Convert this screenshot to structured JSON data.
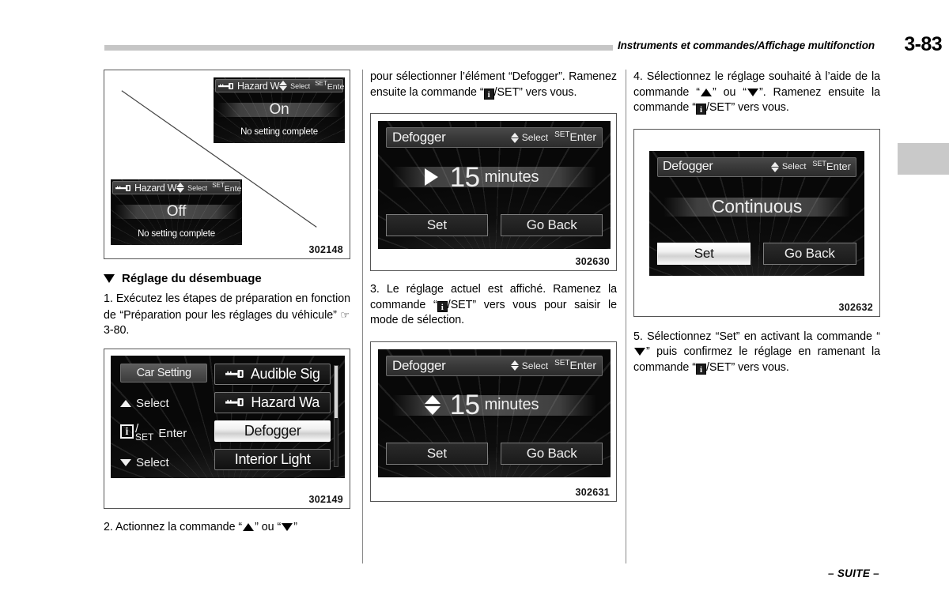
{
  "header": {
    "title": "Instruments et commandes/Affichage multifonction",
    "page_number": "3-83"
  },
  "footer": {
    "continued": "– SUITE –"
  },
  "column1": {
    "figure_hazard": {
      "caption": "302148",
      "screen_on": {
        "title": "Hazard W",
        "hint_select": "Select",
        "hint_set": "SET",
        "hint_enter": "Enter",
        "value": "On",
        "status": "No setting complete"
      },
      "screen_off": {
        "title": "Hazard W",
        "hint_select": "Select",
        "hint_set": "SET",
        "hint_enter": "Enter",
        "value": "Off",
        "status": "No setting complete"
      }
    },
    "section_heading": "Réglage du désembuage",
    "step1_part1": "1.  Exécutez les étapes de préparation en fonction de “Préparation pour les réglages du véhicule” ",
    "step1_ref": "3-80.",
    "figure_menu": {
      "caption": "302149",
      "left_chip": "Car Setting",
      "select_up": "Select",
      "enter_label": "Enter",
      "set_label": "SET",
      "select_down": "Select",
      "items": [
        {
          "label": "Audible Sig",
          "has_key_icon": true,
          "selected": false
        },
        {
          "label": "Hazard Wa",
          "has_key_icon": true,
          "selected": false
        },
        {
          "label": "Defogger",
          "has_key_icon": false,
          "selected": true
        },
        {
          "label": "Interior Light",
          "has_key_icon": false,
          "selected": false
        }
      ]
    },
    "step2_part1": "2.  Actionnez la commande “",
    "step2_part2": "” ou “",
    "step2_part3": "”"
  },
  "column2": {
    "step2_cont_a": "pour sélectionner l’élément “Defogger”. Ramenez ensuite la commande “",
    "step2_cont_b": "/SET” vers vous.",
    "figure_defogger_current": {
      "caption": "302630",
      "title": "Defogger",
      "hint_select": "Select",
      "hint_set": "SET",
      "hint_enter": "Enter",
      "value": "15",
      "unit": "minutes",
      "btn_set": "Set",
      "btn_go_back": "Go Back",
      "indicator": "play-triangle"
    },
    "step3_a": "3.  Le réglage actuel est affiché. Ramenez la commande “",
    "step3_b": "/SET” vers vous pour saisir le mode de sélection.",
    "figure_defogger_select": {
      "caption": "302631",
      "title": "Defogger",
      "hint_select": "Select",
      "hint_set": "SET",
      "hint_enter": "Enter",
      "value": "15",
      "unit": "minutes",
      "btn_set": "Set",
      "btn_go_back": "Go Back",
      "indicator": "up-down-arrows"
    }
  },
  "column3": {
    "step4_a": "4. Sélectionnez le réglage souhaité à l’aide de la commande “",
    "step4_b": "” ou “",
    "step4_c": "”. Ramenez ensuite la commande “",
    "step4_d": "/SET” vers vous.",
    "figure_defogger_continuous": {
      "caption": "302632",
      "title": "Defogger",
      "hint_select": "Select",
      "hint_set": "SET",
      "hint_enter": "Enter",
      "value": "Continuous",
      "btn_set": "Set",
      "btn_go_back": "Go Back",
      "set_selected": true
    },
    "step5_a": "5. Sélectionnez “Set” en activant la commande “",
    "step5_b": "” puis confirmez le réglage en ramenant la commande “",
    "step5_c": "/SET” vers vous."
  },
  "icons": {
    "info": "i",
    "hand_pointer": "☞"
  },
  "colors": {
    "rule": "#c6c6c6",
    "side_tab": "#c9c9c9",
    "lcd_bg": "#080808",
    "text": "#000000"
  }
}
